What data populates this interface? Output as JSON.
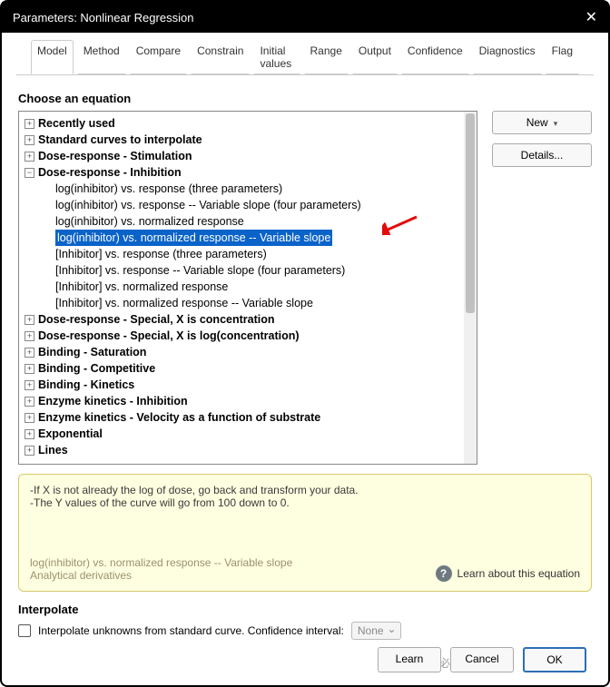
{
  "title": "Parameters: Nonlinear Regression",
  "tabs": [
    "Model",
    "Method",
    "Compare",
    "Constrain",
    "Initial values",
    "Range",
    "Output",
    "Confidence",
    "Diagnostics",
    "Flag"
  ],
  "active_tab": "Model",
  "section_choose": "Choose an equation",
  "side": {
    "new": "New",
    "details": "Details..."
  },
  "tree": {
    "categories": [
      {
        "label": "Recently used",
        "exp": "+"
      },
      {
        "label": "Standard curves to interpolate",
        "exp": "+"
      },
      {
        "label": "Dose-response - Stimulation",
        "exp": "+"
      },
      {
        "label": "Dose-response - Inhibition",
        "exp": "−",
        "children": [
          "log(inhibitor) vs. response (three parameters)",
          "log(inhibitor) vs. response -- Variable slope (four parameters)",
          "log(inhibitor) vs. normalized response",
          "log(inhibitor) vs. normalized response -- Variable slope",
          "[Inhibitor] vs. response (three parameters)",
          "[Inhibitor] vs. response -- Variable slope (four parameters)",
          "[Inhibitor] vs. normalized response",
          "[Inhibitor] vs. normalized response -- Variable slope"
        ],
        "selected_index": 3
      },
      {
        "label": "Dose-response - Special, X is concentration",
        "exp": "+"
      },
      {
        "label": "Dose-response - Special, X is log(concentration)",
        "exp": "+"
      },
      {
        "label": "Binding - Saturation",
        "exp": "+"
      },
      {
        "label": "Binding - Competitive",
        "exp": "+"
      },
      {
        "label": "Binding - Kinetics",
        "exp": "+"
      },
      {
        "label": "Enzyme kinetics - Inhibition",
        "exp": "+"
      },
      {
        "label": "Enzyme kinetics - Velocity as a function of substrate",
        "exp": "+"
      },
      {
        "label": "Exponential",
        "exp": "+"
      },
      {
        "label": "Lines",
        "exp": "+"
      }
    ]
  },
  "info": {
    "note": "-If X is not already the log of dose, go back and transform your data.\n-The Y values of the curve will go from 100 down to 0.",
    "eq_name": "log(inhibitor) vs. normalized response -- Variable slope\nAnalytical derivatives",
    "learn": "Learn about this equation"
  },
  "interpolate": {
    "heading": "Interpolate",
    "checkbox_label": "Interpolate unknowns from standard curve. Confidence interval:",
    "select_value": "None"
  },
  "footer": {
    "learn": "Learn",
    "cancel": "Cancel",
    "ok": "OK"
  },
  "watermark": "头条@投必得论文编译"
}
